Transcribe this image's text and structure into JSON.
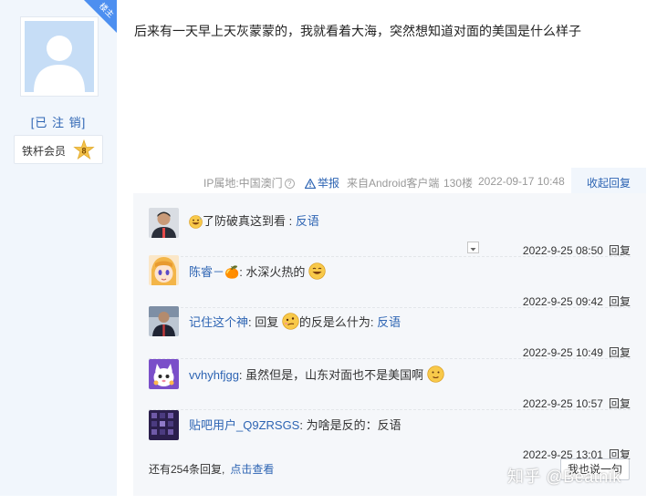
{
  "author": {
    "corner_label": "楼主",
    "username": "[已 注 销]",
    "member_label": "铁杆会员",
    "level": "8"
  },
  "post": {
    "text": "后来有一天早上天灰蒙蒙的，我就看着大海，突然想知道对面的美国是什么样子"
  },
  "meta": {
    "ip": "IP属地:中国澳门",
    "report": "举报",
    "client": "来自Android客户端",
    "floor": "130楼",
    "datetime": "2022-09-17 10:48",
    "collapse": "收起回复"
  },
  "replies": [
    {
      "user": "",
      "text": "了防破真这到看 : ",
      "link": "反语",
      "time": "2022-9-25 08:50",
      "action": "回复",
      "emoji": "grin-sweat-emoji"
    },
    {
      "user": "陈睿－🍊",
      "text": ": 水深火热的",
      "link": "",
      "time": "2022-9-25 09:42",
      "action": "回复",
      "emoji": "smile-emoji"
    },
    {
      "user": "记住这个神",
      "text": ": 回复 ",
      "text2": "的反是么什为: ",
      "link": "反语",
      "time": "2022-9-25 10:49",
      "action": "回复",
      "emoji": "tilted-face-emoji"
    },
    {
      "user": "vvhyhfjgg",
      "text": ": 虽然但是，山东对面也不是美国啊",
      "link": "",
      "time": "2022-9-25 10:57",
      "action": "回复",
      "emoji": "awkward-smile-emoji"
    },
    {
      "user": "贴吧用户_Q9ZRSGS",
      "text": ": 为啥是反的：反语",
      "link": "",
      "time": "2022-9-25 13:01",
      "action": "回复"
    }
  ],
  "footer": {
    "more_replies": "还有254条回复,",
    "view_link": "点击查看",
    "say_button": "我也说一句"
  },
  "watermark": "知乎 @Beatnik",
  "colors": {
    "link": "#2d64b3",
    "sidebar_bg": "#f1f6fc",
    "reply_bg": "#f5f7fa",
    "badge_blue": "#4d8ff0"
  }
}
